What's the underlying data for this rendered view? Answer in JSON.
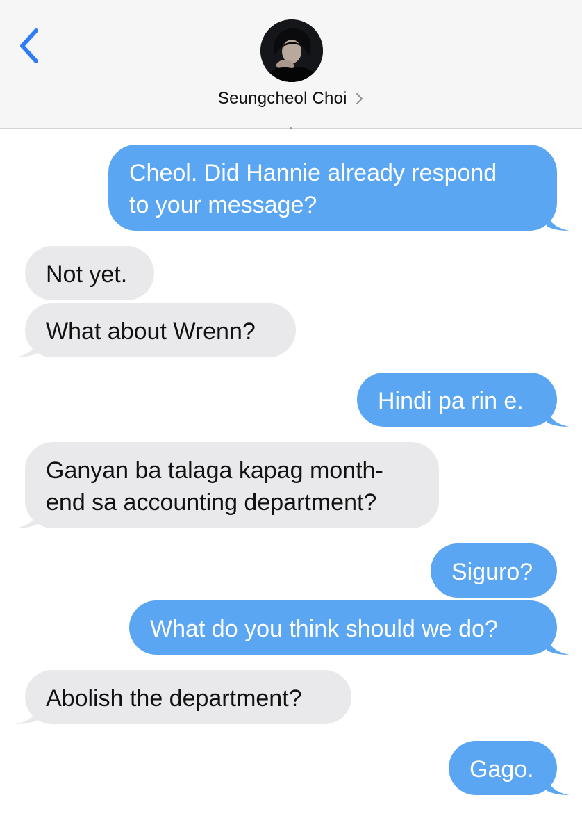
{
  "header": {
    "contact_name": "Seungcheol Choi",
    "back_icon": "chevron-left-icon",
    "disclosure_icon": "chevron-right-icon"
  },
  "colors": {
    "sent_bubble": "#5aa6f2",
    "received_bubble": "#e9e9eb",
    "accent": "#2f7cf6",
    "header_bg": "#f6f6f6"
  },
  "messages": [
    {
      "direction": "sent",
      "lines": [
        "Cheol. Did Hannie already respond",
        "to your message?"
      ]
    },
    {
      "direction": "received",
      "lines": [
        "Not yet."
      ]
    },
    {
      "direction": "received",
      "lines": [
        "What about Wrenn?"
      ]
    },
    {
      "direction": "sent",
      "lines": [
        "Hindi pa rin e."
      ]
    },
    {
      "direction": "received",
      "lines": [
        "Ganyan ba talaga kapag month-",
        "end sa accounting department?"
      ]
    },
    {
      "direction": "sent",
      "lines": [
        "Siguro?"
      ]
    },
    {
      "direction": "sent",
      "lines": [
        "What do you think should we do?"
      ]
    },
    {
      "direction": "received",
      "lines": [
        "Abolish the department?"
      ]
    },
    {
      "direction": "sent",
      "lines": [
        "Gago."
      ]
    }
  ]
}
